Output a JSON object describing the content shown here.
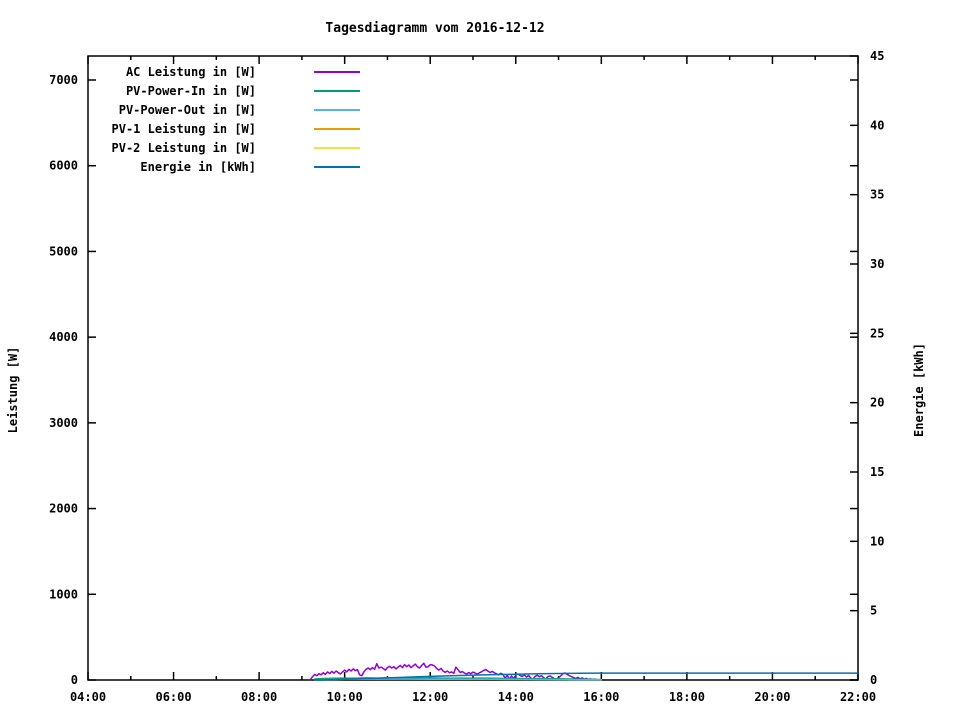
{
  "chart_data": {
    "type": "line",
    "title": "Tagesdiagramm vom 2016-12-12",
    "ylabel": "Leistung [W]",
    "y2label": "Energie [kWh]",
    "xlim_hours": [
      4,
      22
    ],
    "ylim": [
      0,
      7280
    ],
    "y2lim": [
      0,
      45
    ],
    "grid": false,
    "legend_position": "top-left-inside",
    "x_ticks": [
      {
        "h": 4,
        "label": "04:00"
      },
      {
        "h": 6,
        "label": "06:00"
      },
      {
        "h": 8,
        "label": "08:00"
      },
      {
        "h": 10,
        "label": "10:00"
      },
      {
        "h": 12,
        "label": "12:00"
      },
      {
        "h": 14,
        "label": "14:00"
      },
      {
        "h": 16,
        "label": "16:00"
      },
      {
        "h": 18,
        "label": "18:00"
      },
      {
        "h": 20,
        "label": "20:00"
      },
      {
        "h": 22,
        "label": "22:00"
      }
    ],
    "x_minor_tick_hours": [
      5,
      7,
      9,
      11,
      13,
      15,
      17,
      19,
      21
    ],
    "y1_ticks": [
      {
        "v": 0,
        "label": "0"
      },
      {
        "v": 1000,
        "label": "1000"
      },
      {
        "v": 2000,
        "label": "2000"
      },
      {
        "v": 3000,
        "label": "3000"
      },
      {
        "v": 4000,
        "label": "4000"
      },
      {
        "v": 5000,
        "label": "5000"
      },
      {
        "v": 6000,
        "label": "6000"
      },
      {
        "v": 7000,
        "label": "7000"
      }
    ],
    "y2_ticks": [
      {
        "v": 0,
        "label": "0"
      },
      {
        "v": 5,
        "label": "5"
      },
      {
        "v": 10,
        "label": "10"
      },
      {
        "v": 15,
        "label": "15"
      },
      {
        "v": 20,
        "label": "20"
      },
      {
        "v": 25,
        "label": "25"
      },
      {
        "v": 30,
        "label": "30"
      },
      {
        "v": 35,
        "label": "35"
      },
      {
        "v": 40,
        "label": "40"
      },
      {
        "v": 45,
        "label": "45"
      }
    ],
    "series": [
      {
        "name": "AC Leistung in [W]",
        "color": "#9400d3",
        "axis": "y1",
        "hidden_under_border": false,
        "points": [
          [
            9.2,
            5
          ],
          [
            9.25,
            40
          ],
          [
            9.3,
            65
          ],
          [
            9.35,
            50
          ],
          [
            9.4,
            75
          ],
          [
            9.45,
            60
          ],
          [
            9.5,
            85
          ],
          [
            9.55,
            65
          ],
          [
            9.6,
            95
          ],
          [
            9.65,
            75
          ],
          [
            9.7,
            100
          ],
          [
            9.75,
            80
          ],
          [
            9.8,
            105
          ],
          [
            9.85,
            85
          ],
          [
            9.9,
            70
          ],
          [
            9.95,
            95
          ],
          [
            10.0,
            115
          ],
          [
            10.05,
            95
          ],
          [
            10.1,
            125
          ],
          [
            10.15,
            105
          ],
          [
            10.2,
            130
          ],
          [
            10.25,
            110
          ],
          [
            10.3,
            120
          ],
          [
            10.35,
            60
          ],
          [
            10.4,
            50
          ],
          [
            10.45,
            95
          ],
          [
            10.5,
            125
          ],
          [
            10.55,
            140
          ],
          [
            10.6,
            120
          ],
          [
            10.65,
            145
          ],
          [
            10.7,
            125
          ],
          [
            10.75,
            190
          ],
          [
            10.8,
            140
          ],
          [
            10.85,
            150
          ],
          [
            10.9,
            135
          ],
          [
            10.95,
            115
          ],
          [
            11.0,
            145
          ],
          [
            11.05,
            160
          ],
          [
            11.1,
            140
          ],
          [
            11.15,
            155
          ],
          [
            11.2,
            130
          ],
          [
            11.25,
            150
          ],
          [
            11.3,
            170
          ],
          [
            11.35,
            145
          ],
          [
            11.4,
            180
          ],
          [
            11.45,
            155
          ],
          [
            11.5,
            175
          ],
          [
            11.55,
            145
          ],
          [
            11.6,
            165
          ],
          [
            11.65,
            185
          ],
          [
            11.7,
            155
          ],
          [
            11.75,
            140
          ],
          [
            11.8,
            170
          ],
          [
            11.85,
            195
          ],
          [
            11.9,
            150
          ],
          [
            11.95,
            155
          ],
          [
            12.0,
            180
          ],
          [
            12.05,
            175
          ],
          [
            12.1,
            165
          ],
          [
            12.15,
            135
          ],
          [
            12.2,
            115
          ],
          [
            12.25,
            135
          ],
          [
            12.3,
            105
          ],
          [
            12.35,
            90
          ],
          [
            12.4,
            105
          ],
          [
            12.45,
            85
          ],
          [
            12.5,
            95
          ],
          [
            12.55,
            78
          ],
          [
            12.6,
            150
          ],
          [
            12.65,
            120
          ],
          [
            12.7,
            88
          ],
          [
            12.75,
            98
          ],
          [
            12.8,
            82
          ],
          [
            12.85,
            70
          ],
          [
            12.9,
            86
          ],
          [
            12.95,
            74
          ],
          [
            13.0,
            92
          ],
          [
            13.05,
            80
          ],
          [
            13.1,
            68
          ],
          [
            13.15,
            84
          ],
          [
            13.2,
            96
          ],
          [
            13.25,
            112
          ],
          [
            13.3,
            122
          ],
          [
            13.35,
            104
          ],
          [
            13.4,
            88
          ],
          [
            13.45,
            100
          ],
          [
            13.5,
            84
          ],
          [
            13.55,
            72
          ],
          [
            13.6,
            60
          ],
          [
            13.65,
            78
          ],
          [
            13.7,
            66
          ],
          [
            13.75,
            20
          ],
          [
            13.8,
            55
          ],
          [
            13.85,
            10
          ],
          [
            13.9,
            48
          ],
          [
            13.95,
            15
          ],
          [
            14.0,
            58
          ],
          [
            14.05,
            70
          ],
          [
            14.1,
            52
          ],
          [
            14.15,
            42
          ],
          [
            14.2,
            60
          ],
          [
            14.25,
            35
          ],
          [
            14.3,
            52
          ],
          [
            14.35,
            22
          ],
          [
            14.4,
            8
          ],
          [
            14.45,
            42
          ],
          [
            14.5,
            55
          ],
          [
            14.55,
            38
          ],
          [
            14.6,
            50
          ],
          [
            14.65,
            28
          ],
          [
            14.7,
            12
          ],
          [
            14.75,
            38
          ],
          [
            14.8,
            48
          ],
          [
            14.85,
            32
          ],
          [
            14.9,
            18
          ],
          [
            14.95,
            6
          ],
          [
            15.0,
            28
          ],
          [
            15.05,
            48
          ],
          [
            15.1,
            72
          ],
          [
            15.15,
            82
          ],
          [
            15.2,
            65
          ],
          [
            15.25,
            50
          ],
          [
            15.3,
            40
          ],
          [
            15.35,
            28
          ],
          [
            15.4,
            18
          ],
          [
            15.45,
            30
          ],
          [
            15.5,
            14
          ],
          [
            15.55,
            24
          ],
          [
            15.6,
            10
          ],
          [
            15.65,
            18
          ],
          [
            15.7,
            7
          ],
          [
            15.75,
            14
          ],
          [
            15.8,
            4
          ],
          [
            15.85,
            10
          ],
          [
            15.9,
            2
          ]
        ]
      },
      {
        "name": "PV-Power-In in [W]",
        "color": "#009e73",
        "axis": "y1",
        "hidden_under_border": false,
        "points": [
          [
            9.3,
            12
          ],
          [
            9.5,
            18
          ],
          [
            9.75,
            20
          ],
          [
            10.0,
            22
          ],
          [
            10.25,
            20
          ],
          [
            10.5,
            24
          ],
          [
            10.75,
            22
          ],
          [
            11.0,
            25
          ],
          [
            11.25,
            22
          ],
          [
            11.5,
            26
          ],
          [
            11.75,
            22
          ],
          [
            12.0,
            25
          ],
          [
            12.25,
            22
          ],
          [
            12.5,
            20
          ],
          [
            12.75,
            22
          ],
          [
            13.0,
            20
          ],
          [
            13.25,
            22
          ],
          [
            13.5,
            20
          ],
          [
            13.75,
            18
          ],
          [
            14.0,
            18
          ],
          [
            14.25,
            16
          ],
          [
            14.5,
            16
          ],
          [
            14.75,
            14
          ],
          [
            15.0,
            14
          ],
          [
            15.25,
            12
          ],
          [
            15.5,
            10
          ],
          [
            15.75,
            8
          ],
          [
            16.0,
            5
          ]
        ]
      },
      {
        "name": "PV-Power-Out in [W]",
        "color": "#56b4e9",
        "axis": "y1",
        "hidden_under_border": false,
        "points": [
          [
            9.4,
            5
          ],
          [
            10.0,
            8
          ],
          [
            10.5,
            9
          ],
          [
            11.0,
            10
          ],
          [
            11.5,
            10
          ],
          [
            12.0,
            9
          ],
          [
            12.5,
            9
          ],
          [
            13.0,
            8
          ],
          [
            13.5,
            8
          ],
          [
            14.0,
            7
          ],
          [
            14.5,
            6
          ],
          [
            15.0,
            5
          ],
          [
            15.5,
            4
          ],
          [
            16.0,
            3
          ]
        ]
      },
      {
        "name": "PV-1 Leistung in [W]",
        "color": "#e69f00",
        "axis": "y1",
        "hidden_under_border": true,
        "points": [
          [
            9.3,
            2
          ],
          [
            10.0,
            2
          ],
          [
            11.0,
            2
          ],
          [
            12.0,
            2
          ],
          [
            13.0,
            2
          ],
          [
            14.0,
            2
          ],
          [
            15.0,
            2
          ],
          [
            15.9,
            2
          ]
        ]
      },
      {
        "name": "PV-2 Leistung in [W]",
        "color": "#f0e442",
        "axis": "y1",
        "hidden_under_border": true,
        "points": [
          [
            9.3,
            1
          ],
          [
            10.0,
            1
          ],
          [
            11.0,
            1
          ],
          [
            12.0,
            1
          ],
          [
            13.0,
            1
          ],
          [
            14.0,
            1
          ],
          [
            15.0,
            1
          ],
          [
            15.9,
            1
          ]
        ]
      },
      {
        "name": "Energie in [kWh]",
        "color": "#0072b2",
        "axis": "y2",
        "hidden_under_border": false,
        "points": [
          [
            9.3,
            0.0
          ],
          [
            9.5,
            0.01
          ],
          [
            9.75,
            0.03
          ],
          [
            10.0,
            0.05
          ],
          [
            10.25,
            0.07
          ],
          [
            10.5,
            0.1
          ],
          [
            10.75,
            0.12
          ],
          [
            11.0,
            0.15
          ],
          [
            11.25,
            0.18
          ],
          [
            11.5,
            0.21
          ],
          [
            12.0,
            0.26
          ],
          [
            12.5,
            0.31
          ],
          [
            13.0,
            0.35
          ],
          [
            13.5,
            0.39
          ],
          [
            14.0,
            0.42
          ],
          [
            14.5,
            0.45
          ],
          [
            15.0,
            0.47
          ],
          [
            15.5,
            0.49
          ],
          [
            16.0,
            0.5
          ],
          [
            22.0,
            0.5
          ]
        ]
      }
    ]
  },
  "colors": {
    "background": "#ffffff",
    "border": "#000000",
    "text": "#000000"
  }
}
